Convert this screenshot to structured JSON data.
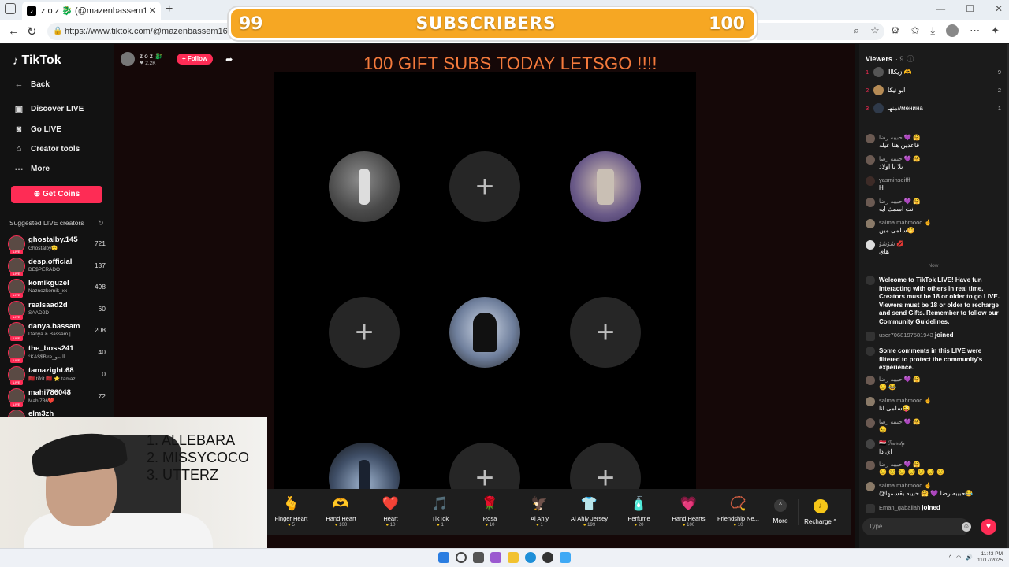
{
  "browser": {
    "tab_title": "z o z 🐉 (@mazenbassem163) is",
    "url": "https://www.tiktok.com/@mazenbassem163/live"
  },
  "overlay": {
    "subs_current": "99",
    "subs_label": "SUBSCRIBERS",
    "subs_goal": "100"
  },
  "sidebar": {
    "logo": "TikTok",
    "back": "Back",
    "nav": [
      {
        "label": "Discover LIVE",
        "icon": "live-icon"
      },
      {
        "label": "Go LIVE",
        "icon": "camera-icon"
      },
      {
        "label": "Creator tools",
        "icon": "home-icon"
      },
      {
        "label": "More",
        "icon": "dots-icon"
      }
    ],
    "coins_button": "Get Coins",
    "suggested_title": "Suggested LIVE creators",
    "creators": [
      {
        "name": "ghostalby.145",
        "sub": "Ghostalby🫡",
        "count": "721"
      },
      {
        "name": "desp.official",
        "sub": "DE$PERADO",
        "count": "137"
      },
      {
        "name": "komikguzel",
        "sub": "Naznozkomik_xx",
        "count": "498"
      },
      {
        "name": "realsaad2d",
        "sub": "SAAD2D",
        "count": "60"
      },
      {
        "name": "danya.bassam",
        "sub": "Danya & Bassam | ...",
        "count": "208"
      },
      {
        "name": "the_boss241",
        "sub": "°KA$$Bire_السو",
        "count": "40"
      },
      {
        "name": "tamazight.68",
        "sub": "🇲🇦 tifrit 🇲🇦 ⭐ tamaz...",
        "count": "0"
      },
      {
        "name": "mahi786048",
        "sub": "Mahi786❤️",
        "count": "72"
      },
      {
        "name": "elm3zh",
        "sub": "",
        "count": "..."
      }
    ]
  },
  "stream": {
    "host_name": "z o z 🐉",
    "host_likes": "❤ 2.2K",
    "follow_label": "+ Follow",
    "title": "100 GIFT SUBS TODAY LETSGO !!!!"
  },
  "winners": [
    "1.  ALLEBARA",
    "2.  MISSYCOCO",
    "3.  UTTERZ"
  ],
  "gifts": [
    {
      "name": "Finger Heart",
      "price": "5",
      "icon": "🫰"
    },
    {
      "name": "Hand Heart",
      "price": "100",
      "icon": "🫶"
    },
    {
      "name": "Heart",
      "price": "10",
      "icon": "❤️"
    },
    {
      "name": "TikTok",
      "price": "1",
      "icon": "🎵"
    },
    {
      "name": "Rosa",
      "price": "10",
      "icon": "🌹"
    },
    {
      "name": "Al Ahly",
      "price": "1",
      "icon": "🦅"
    },
    {
      "name": "Al Ahly Jersey",
      "price": "199",
      "icon": "👕"
    },
    {
      "name": "Perfume",
      "price": "20",
      "icon": "🧴"
    },
    {
      "name": "Hand Hearts",
      "price": "100",
      "icon": "💗"
    },
    {
      "name": "Friendship Ne...",
      "price": "10",
      "icon": "📿"
    }
  ],
  "gift_more": "More",
  "recharge": "Recharge ^",
  "chat": {
    "viewers_label": "Viewers",
    "viewers_count": "· 9",
    "top_viewers": [
      {
        "rank": "1",
        "name": "lllزيكا 🫶",
        "score": "9"
      },
      {
        "rank": "2",
        "name": "ابو نيكا",
        "score": "2"
      },
      {
        "rank": "3",
        "name": "منهـ//менина",
        "score": "1"
      }
    ],
    "messages": [
      {
        "user": "حبيبه رضا 💜 🤗",
        "text": "قاعدين هنا عيله"
      },
      {
        "user": "حبيبه رضا 💜 🤗",
        "text": "يلا يا اولاد"
      },
      {
        "user": "yasminseifff",
        "text": "Hi"
      },
      {
        "user": "حبيبه رضا 💜 🤗",
        "text": "انت اسمك ايه"
      },
      {
        "user": "salma mahmood 🤞 ...",
        "text": "سلمى مين🤭"
      },
      {
        "user": "شَوْشَوْ 💋",
        "text": "هاي"
      }
    ],
    "now_label": "Now",
    "welcome": "Welcome to TikTok LIVE! Have fun interacting with others in real time. Creators must be 18 or older to go LIVE. Viewers must be 18 or older to recharge and send Gifts. Remember to follow our Community Guidelines.",
    "joined1_user": "user7068197581943",
    "joined1_text": "joined",
    "filtered": "Some comments in this LIVE were filtered to protect the community's experience.",
    "messages2": [
      {
        "user": "حبيبه رضا 💜 🤗",
        "text": "😣 😂"
      },
      {
        "user": "salma mahmood 🤞 ...",
        "text": "سلمى انا😜"
      },
      {
        "user": "حبيبه رضا 💜 🤗",
        "text": "😣"
      },
      {
        "user": "🇪🇬 ℛ𝒶𝓇𝒹𝓎",
        "text": "اي دا"
      },
      {
        "user": "حبيبه رضا 💜 🤗",
        "text": "😣 😣 😣 😣 😣 😣 😣"
      },
      {
        "user": "salma mahmood 🤞 ...",
        "text": "@حبيبه رضا 💜 🤗 حبيبه بقسمها😂"
      }
    ],
    "joined2_user": "Eman_gaballah",
    "joined2_text": "joined",
    "input_placeholder": "Type..."
  },
  "taskbar": {
    "time": "11:43 PM",
    "date": "11/17/2025"
  }
}
